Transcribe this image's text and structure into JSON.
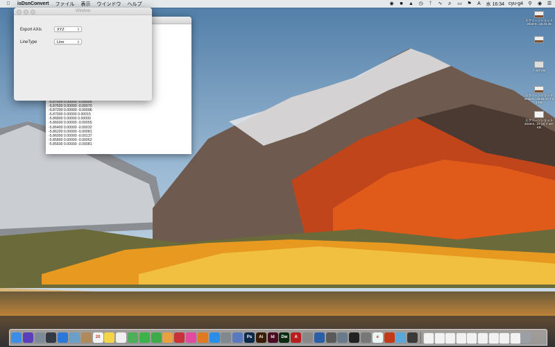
{
  "menubar": {
    "apple_icon": "apple-icon",
    "app_name": "isDsnConvert",
    "menus": [
      "ファイル",
      "表示",
      "ウインドウ",
      "ヘルプ"
    ],
    "clock": "水 16:34",
    "user": "cyu-g4"
  },
  "desktop": {
    "items": [
      {
        "label": "スクリーンショット 2018-0...16.23.45"
      },
      {
        "label": ""
      },
      {
        "label": "7 447 KB"
      },
      {
        "label": "スクリーンショット 2018-0...16.34.17 7 4 1 KB"
      },
      {
        "label": "スクリーンショット 2018-0...17 (2) 7 447 KB"
      }
    ]
  },
  "settings_window": {
    "title": "Window",
    "export_axis_label": "Export AXis",
    "export_axis_value": "XYZ",
    "linetype_label": "LineType",
    "linetype_value": "Line"
  },
  "text_window": {
    "lines": [
      "-5.87600 0.00000 -0.00005",
      "-5.87600 0.00000 -0.00070",
      "-5.87200 0.00000 -0.00096",
      "-5.87000 0.00000 0.00015",
      "-5.86800 0.00000 0.00000",
      "-5.86600 0.00000 -0.00055",
      "-5.86400 0.00000 -0.00032",
      "-5.86200 0.00000 -0.00081",
      "-5.86000 0.00000 -0.00137",
      "-5.85800 0.00000 -0.00062",
      "-5.85600 0.00000 -0.00081"
    ]
  },
  "dock": {
    "icons": [
      {
        "name": "finder-icon",
        "color": "#3a8ee6",
        "label": ""
      },
      {
        "name": "siri-icon",
        "color": "#5b3fb8",
        "label": ""
      },
      {
        "name": "launchpad-icon",
        "color": "#7d8a9a",
        "label": ""
      },
      {
        "name": "mission-control-icon",
        "color": "#333a44",
        "label": ""
      },
      {
        "name": "safari-icon",
        "color": "#2a78d8",
        "label": ""
      },
      {
        "name": "preview-icon",
        "color": "#6aa0c8",
        "label": ""
      },
      {
        "name": "contacts-icon",
        "color": "#b08a5a",
        "label": ""
      },
      {
        "name": "calendar-icon",
        "color": "#f4f4f4",
        "label": "20"
      },
      {
        "name": "notes-icon",
        "color": "#f5d547",
        "label": ""
      },
      {
        "name": "reminders-icon",
        "color": "#f0f0f0",
        "label": ""
      },
      {
        "name": "maps-icon",
        "color": "#4fae5a",
        "label": ""
      },
      {
        "name": "messages-icon",
        "color": "#3bb34a",
        "label": ""
      },
      {
        "name": "facetime-icon",
        "color": "#3faa4a",
        "label": ""
      },
      {
        "name": "photos-icon",
        "color": "#e8a040",
        "label": ""
      },
      {
        "name": "photo-booth-icon",
        "color": "#c8303a",
        "label": ""
      },
      {
        "name": "itunes-icon",
        "color": "#e04aa0",
        "label": ""
      },
      {
        "name": "ibooks-icon",
        "color": "#e07a20",
        "label": ""
      },
      {
        "name": "app-store-icon",
        "color": "#2a8ee8",
        "label": ""
      },
      {
        "name": "system-preferences-icon",
        "color": "#808890",
        "label": ""
      },
      {
        "name": "utility-app-icon",
        "color": "#5a7ac0",
        "label": ""
      },
      {
        "name": "photoshop-icon",
        "color": "#0b2a4a",
        "label": "Ps"
      },
      {
        "name": "illustrator-icon",
        "color": "#3a1a00",
        "label": "Ai"
      },
      {
        "name": "indesign-icon",
        "color": "#4a0a22",
        "label": "Id"
      },
      {
        "name": "dreamweaver-icon",
        "color": "#0a2a10",
        "label": "Dw"
      },
      {
        "name": "acrobat-icon",
        "color": "#b81e1e",
        "label": "A"
      },
      {
        "name": "disk-utility-icon",
        "color": "#888",
        "label": ""
      },
      {
        "name": "xcode-icon",
        "color": "#2a5fa8",
        "label": ""
      },
      {
        "name": "screenshot-app-icon",
        "color": "#5a5a5a",
        "label": ""
      },
      {
        "name": "image-capture-icon",
        "color": "#6a7a8a",
        "label": ""
      },
      {
        "name": "terminal-icon",
        "color": "#222",
        "label": ""
      },
      {
        "name": "archive-icon",
        "color": "#777",
        "label": ""
      },
      {
        "name": "isdsnconvert-icon",
        "color": "#e8f6f4",
        "label": "e"
      },
      {
        "name": "rss-app-icon",
        "color": "#c23a1a",
        "label": ""
      },
      {
        "name": "utility2-icon",
        "color": "#5aa8d8",
        "label": ""
      },
      {
        "name": "app-icon-2",
        "color": "#3a3a3a",
        "label": ""
      }
    ],
    "folders": 9,
    "trash_icon": "trash-icon"
  }
}
